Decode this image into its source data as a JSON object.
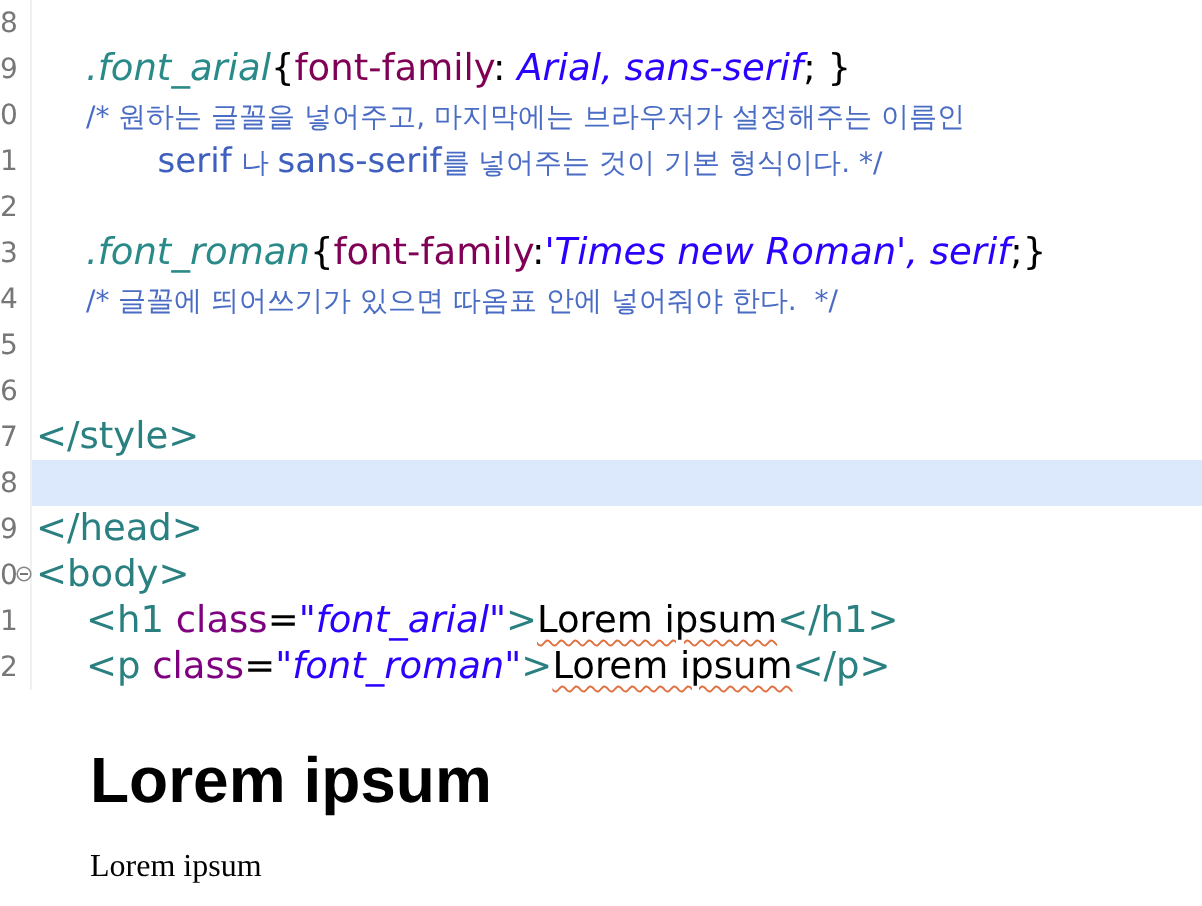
{
  "editor": {
    "lines": [
      {
        "number": "8",
        "highlighted": false,
        "foldable": false
      },
      {
        "number": "9",
        "highlighted": false,
        "foldable": false,
        "tokens": [
          {
            "kind": "selector",
            "text": "\t.font_arial"
          },
          {
            "kind": "punct",
            "text": "{"
          },
          {
            "kind": "property",
            "text": "font-family"
          },
          {
            "kind": "punct",
            "text": ": "
          },
          {
            "kind": "value",
            "text": "Arial, sans-serif"
          },
          {
            "kind": "punct",
            "text": "; }"
          }
        ]
      },
      {
        "number": "0",
        "highlighted": false,
        "foldable": false,
        "tokens": [
          {
            "kind": "comment",
            "text": "\t/* 원하는 글꼴을 넣어주고, 마지막에는 브라우저가 설정해주는 이름인"
          }
        ]
      },
      {
        "number": "1",
        "highlighted": false,
        "foldable": false,
        "tokens": [
          {
            "kind": "comment_word",
            "text": "\t\t  serif"
          },
          {
            "kind": "comment",
            "text": " 나 "
          },
          {
            "kind": "comment_word",
            "text": "sans-serif"
          },
          {
            "kind": "comment",
            "text": "를 넣어주는 것이 기본 형식이다. */"
          }
        ]
      },
      {
        "number": "2",
        "highlighted": false,
        "foldable": false
      },
      {
        "number": "3",
        "highlighted": false,
        "foldable": false,
        "tokens": [
          {
            "kind": "selector",
            "text": "\t.font_roman"
          },
          {
            "kind": "punct",
            "text": "{"
          },
          {
            "kind": "property",
            "text": "font-family"
          },
          {
            "kind": "punct",
            "text": ":"
          },
          {
            "kind": "value",
            "text": "'Times new Roman', serif"
          },
          {
            "kind": "punct",
            "text": ";}"
          }
        ]
      },
      {
        "number": "4",
        "highlighted": false,
        "foldable": false,
        "tokens": [
          {
            "kind": "comment",
            "text": "\t/* 글꼴에 띄어쓰기가 있으면 따옴표 안에 넣어줘야 한다.  */"
          }
        ]
      },
      {
        "number": "5",
        "highlighted": false,
        "foldable": false
      },
      {
        "number": "6",
        "highlighted": false,
        "foldable": false
      },
      {
        "number": "7",
        "highlighted": false,
        "foldable": false,
        "tokens": [
          {
            "kind": "tag",
            "text": "</style>"
          }
        ]
      },
      {
        "number": "8",
        "highlighted": true,
        "foldable": false
      },
      {
        "number": "9",
        "highlighted": false,
        "foldable": false,
        "tokens": [
          {
            "kind": "tag",
            "text": "</head>"
          }
        ]
      },
      {
        "number": "0",
        "highlighted": false,
        "foldable": true,
        "tokens": [
          {
            "kind": "tag",
            "text": "<body>"
          }
        ]
      },
      {
        "number": "1",
        "highlighted": false,
        "foldable": false,
        "tokens": [
          {
            "kind": "tag",
            "text": "\t<h1 "
          },
          {
            "kind": "attr",
            "text": "class"
          },
          {
            "kind": "punct",
            "text": "="
          },
          {
            "kind": "string",
            "text": "\"font_arial\""
          },
          {
            "kind": "tag",
            "text": ">"
          },
          {
            "kind": "misspelled",
            "text": "Lorem ipsum"
          },
          {
            "kind": "tag",
            "text": "</h1>"
          }
        ]
      },
      {
        "number": "2",
        "highlighted": false,
        "foldable": false,
        "tokens": [
          {
            "kind": "tag",
            "text": "\t<p "
          },
          {
            "kind": "attr",
            "text": "class"
          },
          {
            "kind": "punct",
            "text": "="
          },
          {
            "kind": "string",
            "text": "\"font_roman\""
          },
          {
            "kind": "tag",
            "text": ">"
          },
          {
            "kind": "misspelled",
            "text": "Lorem ipsum"
          },
          {
            "kind": "tag",
            "text": "</p>"
          }
        ]
      }
    ]
  },
  "preview": {
    "heading": "Lorem ipsum",
    "paragraph": "Lorem ipsum"
  }
}
